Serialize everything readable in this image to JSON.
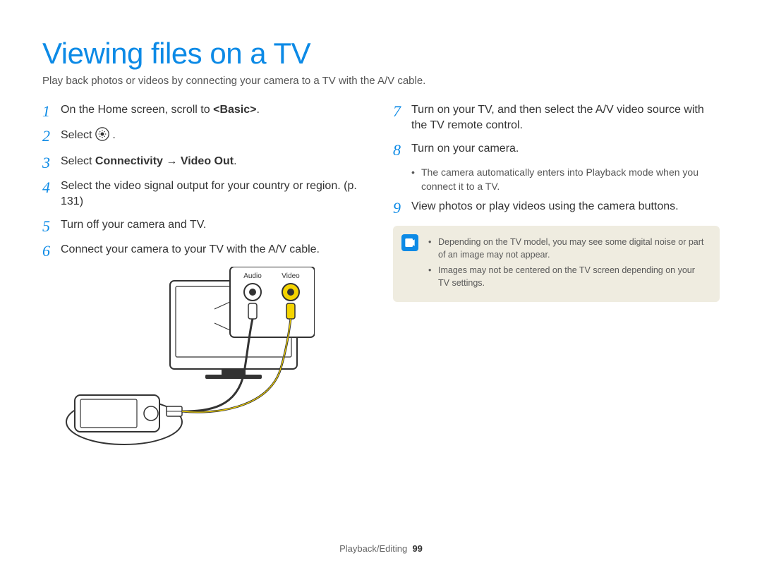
{
  "title": "Viewing files on a TV",
  "intro": "Play back photos or videos by connecting your camera to a TV with the A/V cable.",
  "left": {
    "step1": {
      "num": "1",
      "pre": "On the Home screen, scroll to ",
      "bold": "<Basic>",
      "post": "."
    },
    "step2": {
      "num": "2",
      "text": "Select "
    },
    "step3": {
      "num": "3",
      "pre": "Select ",
      "bold1": "Connectivity",
      "arrow": " → ",
      "bold2": "Video Out",
      "post": "."
    },
    "step4": {
      "num": "4",
      "text": "Select the video signal output for your country or region. (p. 131)"
    },
    "step5": {
      "num": "5",
      "text": "Turn off your camera and TV."
    },
    "step6": {
      "num": "6",
      "text": "Connect your camera to your TV with the A/V cable."
    }
  },
  "right": {
    "step7": {
      "num": "7",
      "text": "Turn on your TV, and then select the A/V video source with the TV remote control."
    },
    "step8": {
      "num": "8",
      "text": "Turn on your camera."
    },
    "step8_sub": "The camera automatically enters into Playback mode when you connect it to a TV.",
    "step9": {
      "num": "9",
      "text": "View photos or play videos using the camera buttons."
    },
    "note1": "Depending on the TV model, you may see some digital noise or part of an image may not appear.",
    "note2": "Images may not be centered on the TV screen depending on your TV settings."
  },
  "diagram": {
    "audio": "Audio",
    "video": "Video"
  },
  "footer": {
    "section": "Playback/Editing",
    "page": "99"
  }
}
